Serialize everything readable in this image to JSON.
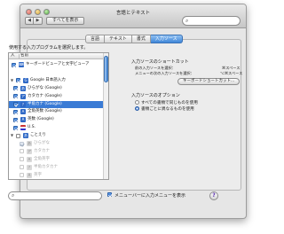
{
  "window": {
    "title": "言語とテキスト"
  },
  "toolbar": {
    "back": "◀",
    "forward": "▶",
    "show_all": "すべてを表示",
    "search_placeholder": ""
  },
  "tabs": [
    {
      "label": "言語",
      "active": false
    },
    {
      "label": "テキスト",
      "active": false
    },
    {
      "label": "書式",
      "active": false
    },
    {
      "label": "入力ソース",
      "active": true
    }
  ],
  "input_sources": {
    "title": "使用する入力プログラムを選択します。",
    "header": {
      "col1": "入",
      "col2": "名前"
    },
    "rows": [
      {
        "label": "キーボードビューアと文字ビューア",
        "checked": true,
        "icon": "keyboard-icon",
        "icon_text": "⌨"
      },
      {
        "label": "",
        "checked": false,
        "icon": "",
        "icon_text": ""
      },
      {
        "label": "Google 日本語入力",
        "checked": true,
        "icon": "google-ime-icon",
        "icon_text": "G",
        "expanded": true
      },
      {
        "label": "ひらがな (Google)",
        "checked": true,
        "icon": "hiragana-icon",
        "icon_text": "あ"
      },
      {
        "label": "カタカナ (Google)",
        "checked": true,
        "icon": "katakana-icon",
        "icon_text": "ア"
      },
      {
        "label": "半角カナ (Google)",
        "checked": true,
        "icon": "halfwidth-kana-icon",
        "icon_text": "ｱ",
        "selected": true
      },
      {
        "label": "全角英数 (Google)",
        "checked": true,
        "icon": "fullwidth-alnum-icon",
        "icon_text": "Ａ"
      },
      {
        "label": "英数 (Google)",
        "checked": true,
        "icon": "alnum-icon",
        "icon_text": "A"
      },
      {
        "label": "U.S.",
        "checked": true,
        "icon": "us-flag-icon",
        "icon_text": ""
      },
      {
        "label": "ことえり",
        "checked": false,
        "icon": "kotoeri-icon",
        "icon_text": "あ",
        "expanded": true
      },
      {
        "label": "ひらがな",
        "checked": true,
        "icon": "hiragana-icon",
        "icon_text": "あ",
        "dim": true
      },
      {
        "label": "カタカナ",
        "checked": false,
        "icon": "katakana-icon",
        "icon_text": "ア",
        "dim": true
      },
      {
        "label": "全角英字",
        "checked": false,
        "icon": "fullwidth-alpha-icon",
        "icon_text": "Ａ",
        "dim": true
      },
      {
        "label": "半角カタカナ",
        "checked": false,
        "icon": "halfwidth-kana-icon",
        "icon_text": "ｱ",
        "dim": true
      },
      {
        "label": "英字",
        "checked": false,
        "icon": "alpha-icon",
        "icon_text": "A",
        "dim": true
      }
    ]
  },
  "shortcuts": {
    "title": "入力ソースのショートカット",
    "prev_label": "前の入力ソースを選択：",
    "prev_value": "⌘スペース",
    "next_label": "メニューの次の入力ソースを選択：",
    "next_value": "⌥⌘スペース",
    "button": "キーボードショートカット..."
  },
  "options": {
    "title": "入力ソースのオプション",
    "same_all": "すべての書類で同じものを使用",
    "per_document": "書類ごとに異なるものを使用",
    "selected": "per_document"
  },
  "bottom": {
    "search_placeholder": "",
    "show_in_menubar": "メニューバーに入力メニューを表示",
    "show_in_menubar_checked": true,
    "help": "?"
  }
}
